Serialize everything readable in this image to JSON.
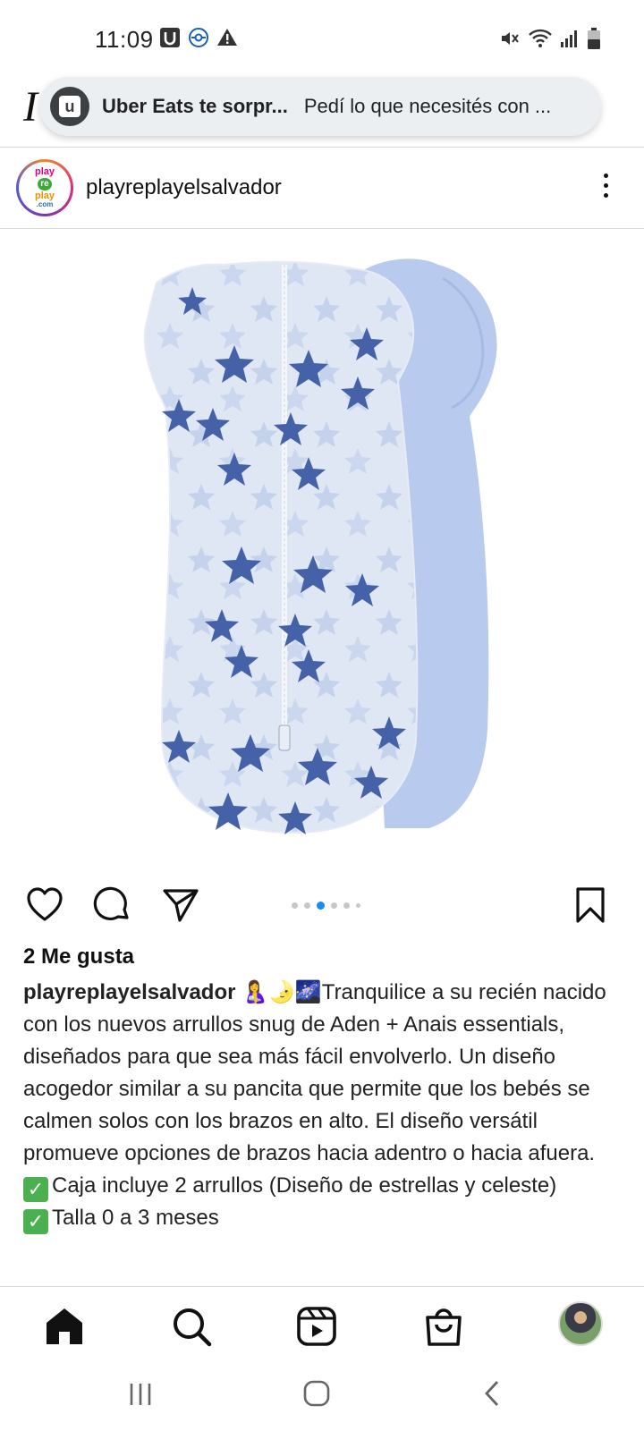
{
  "status_bar": {
    "time": "11:09",
    "left_icons": [
      "uber-app-icon",
      "location-sync-icon",
      "warning-icon"
    ],
    "right_icons": [
      "mute-icon",
      "wifi-icon",
      "signal-icon",
      "battery-icon"
    ]
  },
  "toast": {
    "app_icon": "uber-eats-icon",
    "title": "Uber Eats te sorpr...",
    "text": "Pedí lo que necesités con ..."
  },
  "post": {
    "username": "playreplayelsalvador",
    "avatar_text": [
      "play",
      "re",
      "play",
      ".com"
    ],
    "image_description_icon": "baby-swaddle-image",
    "carousel": {
      "count": 6,
      "active_index": 2
    },
    "likes": "2 Me gusta",
    "caption": {
      "user": "playreplayelsalvador",
      "emojis": "🤱🌛🌌",
      "line1": "Tranquilice a su recién nacido con los nuevos arrullos snug de Aden + Anais essentials, diseñados para que sea más fácil envolverlo. Un diseño acogedor similar a su pancita que permite que los bebés se calmen solos con los brazos en alto. El diseño versátil promueve opciones de brazos hacia adentro o hacia afuera.",
      "item1": "Caja incluye 2 arrullos (Diseño de estrellas y celeste)",
      "item2": "Talla 0 a 3 meses"
    }
  },
  "bottom_nav": [
    "home-icon",
    "search-icon",
    "reels-icon",
    "shop-icon",
    "profile-avatar"
  ],
  "system_nav": [
    "recents-icon",
    "home-button-icon",
    "back-icon"
  ],
  "colors": {
    "accent_blue": "#1a8cf0",
    "swaddle_light": "#b9c9ea",
    "star_blue": "#3f5da8"
  }
}
